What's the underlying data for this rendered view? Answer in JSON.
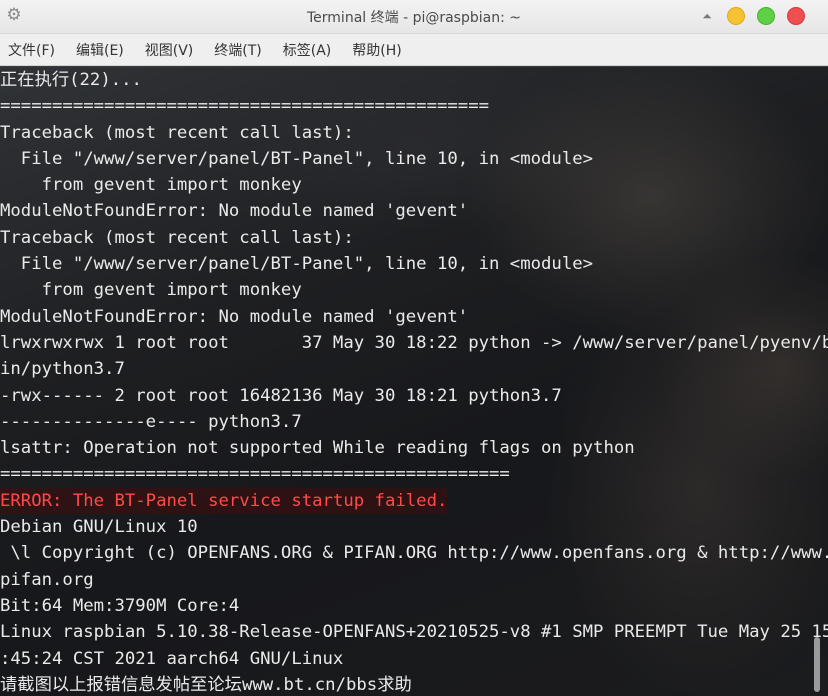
{
  "window": {
    "title": "Terminal 终端 - pi@raspbian: ~"
  },
  "icons": {
    "settings": "gear-icon",
    "up": "chevron-up-icon",
    "minimize": "minimize-icon",
    "maximize": "maximize-icon",
    "close": "close-icon"
  },
  "colors": {
    "error_text": "#ff4a4a",
    "close_button": "#ef4f4f",
    "minimize_button": "#f5c232",
    "maximize_button": "#5fd046"
  },
  "menu": [
    {
      "label": "文件(F)"
    },
    {
      "label": "编辑(E)"
    },
    {
      "label": "视图(V)"
    },
    {
      "label": "终端(T)"
    },
    {
      "label": "标签(A)"
    },
    {
      "label": "帮助(H)"
    }
  ],
  "terminal": {
    "lines": [
      {
        "text": "正在执行(22)...",
        "type": "normal"
      },
      {
        "text": "===============================================",
        "type": "normal"
      },
      {
        "text": "Traceback (most recent call last):",
        "type": "normal"
      },
      {
        "text": "  File \"/www/server/panel/BT-Panel\", line 10, in <module>",
        "type": "normal"
      },
      {
        "text": "    from gevent import monkey",
        "type": "normal"
      },
      {
        "text": "ModuleNotFoundError: No module named 'gevent'",
        "type": "normal"
      },
      {
        "text": "Traceback (most recent call last):",
        "type": "normal"
      },
      {
        "text": "  File \"/www/server/panel/BT-Panel\", line 10, in <module>",
        "type": "normal"
      },
      {
        "text": "    from gevent import monkey",
        "type": "normal"
      },
      {
        "text": "ModuleNotFoundError: No module named 'gevent'",
        "type": "normal"
      },
      {
        "text": "lrwxrwxrwx 1 root root       37 May 30 18:22 python -> /www/server/panel/pyenv/b",
        "type": "normal"
      },
      {
        "text": "in/python3.7",
        "type": "normal"
      },
      {
        "text": "-rwx------ 2 root root 16482136 May 30 18:21 python3.7",
        "type": "normal"
      },
      {
        "text": "--------------e---- python3.7",
        "type": "normal"
      },
      {
        "text": "lsattr: Operation not supported While reading flags on python",
        "type": "normal"
      },
      {
        "text": "=================================================",
        "type": "normal"
      },
      {
        "text": "ERROR: The BT-Panel service startup failed.",
        "type": "error"
      },
      {
        "text": "Debian GNU/Linux 10",
        "type": "normal"
      },
      {
        "text": " \\l Copyright (c) OPENFANS.ORG & PIFAN.ORG http://www.openfans.org & http://www.",
        "type": "normal"
      },
      {
        "text": "pifan.org",
        "type": "normal"
      },
      {
        "text": "Bit:64 Mem:3790M Core:4",
        "type": "normal"
      },
      {
        "text": "Linux raspbian 5.10.38-Release-OPENFANS+20210525-v8 #1 SMP PREEMPT Tue May 25 15",
        "type": "normal"
      },
      {
        "text": ":45:24 CST 2021 aarch64 GNU/Linux",
        "type": "normal"
      },
      {
        "text": "请截图以上报错信息发帖至论坛www.bt.cn/bbs求助",
        "type": "normal"
      }
    ]
  }
}
